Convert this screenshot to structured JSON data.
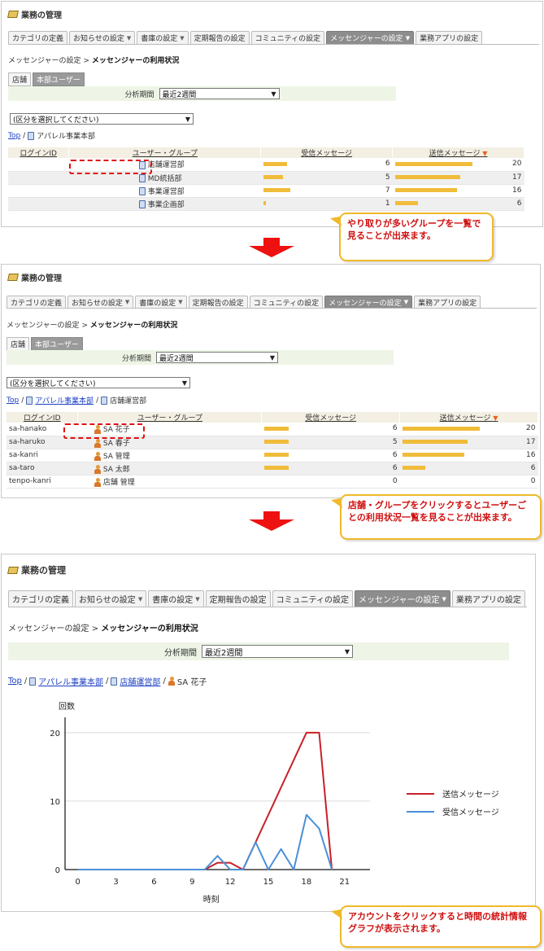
{
  "header_title": "業務の管理",
  "tabs": [
    {
      "label": "カテゴリの定義",
      "dropdown": false
    },
    {
      "label": "お知らせの設定",
      "dropdown": true
    },
    {
      "label": "書庫の設定",
      "dropdown": true
    },
    {
      "label": "定期報告の設定",
      "dropdown": false
    },
    {
      "label": "コミュニティの設定",
      "dropdown": false
    },
    {
      "label": "メッセンジャーの設定",
      "dropdown": true,
      "active": true
    },
    {
      "label": "業務アプリの設定",
      "dropdown": false
    }
  ],
  "breadcrumb": {
    "parent": "メッセンジャーの設定",
    "separator": ">",
    "current": "メッセンジャーの利用状況"
  },
  "subtabs": [
    "店舗",
    "本部ユーザー"
  ],
  "period_label": "分析期間",
  "period_value": "最近2週間",
  "division_placeholder": "(区分を選択してください)",
  "nav": {
    "top": "Top",
    "sep": "/",
    "apparel": "アパレル事業本部",
    "store_ops": "店舗運営部",
    "user": "SA 花子"
  },
  "columns": {
    "login_id": "ログインID",
    "user_group": "ユーザー・グループ",
    "received": "受信メッセージ",
    "sent": "送信メッセージ"
  },
  "panel1_rows": [
    {
      "login_id": "",
      "name": "店舗運営部",
      "received": "6",
      "received_frac": 0.29,
      "sent": "20",
      "sent_frac": 0.95
    },
    {
      "login_id": "",
      "name": "MD統括部",
      "received": "5",
      "received_frac": 0.24,
      "sent": "17",
      "sent_frac": 0.8
    },
    {
      "login_id": "",
      "name": "事業運営部",
      "received": "7",
      "received_frac": 0.33,
      "sent": "16",
      "sent_frac": 0.76
    },
    {
      "login_id": "",
      "name": "事業企画部",
      "received": "1",
      "received_frac": 0.03,
      "sent": "6",
      "sent_frac": 0.28
    }
  ],
  "panel2_rows": [
    {
      "login_id": "sa-hanako",
      "name": "SA 花子",
      "received": "6",
      "received_frac": 0.3,
      "sent": "20",
      "sent_frac": 0.95
    },
    {
      "login_id": "sa-haruko",
      "name": "SA 春子",
      "received": "5",
      "received_frac": 0.3,
      "sent": "17",
      "sent_frac": 0.8
    },
    {
      "login_id": "sa-kanri",
      "name": "SA 管理",
      "received": "6",
      "received_frac": 0.3,
      "sent": "16",
      "sent_frac": 0.76
    },
    {
      "login_id": "sa-taro",
      "name": "SA 太郎",
      "received": "6",
      "received_frac": 0.3,
      "sent": "6",
      "sent_frac": 0.28
    },
    {
      "login_id": "tenpo-kanri",
      "name": "店舗 管理",
      "received": "0",
      "received_frac": 0,
      "sent": "0",
      "sent_frac": 0
    }
  ],
  "callouts": [
    "やり取りが多いグループを一覧で見ることが出来ます。",
    "店舗・グループをクリックするとユーザーごとの利用状況一覧を見ることが出来ます。",
    "アカウントをクリックすると時間の統計情報グラフが表示されます。"
  ],
  "colors": {
    "sent": "#c8202a",
    "received": "#4a8fd8",
    "bar": "#f0bc3a",
    "callout_border": "#f0b92a",
    "arrow": "#e11111"
  },
  "chart_data": {
    "type": "line",
    "ylabel": "回数",
    "xlabel": "時刻",
    "xlim": [
      -1,
      23
    ],
    "ylim": [
      0,
      22
    ],
    "xticks": [
      0,
      3,
      6,
      9,
      12,
      15,
      18,
      21
    ],
    "yticks": [
      0,
      10,
      20
    ],
    "grid": true,
    "legend_position": "right",
    "series": [
      {
        "name": "送信メッセージ",
        "color": "#c8202a",
        "points": [
          [
            0,
            0
          ],
          [
            10,
            0
          ],
          [
            11,
            1
          ],
          [
            12,
            1
          ],
          [
            13,
            0
          ],
          [
            18,
            20
          ],
          [
            19,
            20
          ],
          [
            20,
            0
          ]
        ]
      },
      {
        "name": "受信メッセージ",
        "color": "#4a8fd8",
        "points": [
          [
            0,
            0
          ],
          [
            10,
            0
          ],
          [
            11,
            2
          ],
          [
            12,
            0
          ],
          [
            13,
            0
          ],
          [
            14,
            4
          ],
          [
            15,
            0
          ],
          [
            16,
            3
          ],
          [
            17,
            0
          ],
          [
            18,
            8
          ],
          [
            19,
            6
          ],
          [
            20,
            0
          ]
        ]
      }
    ]
  }
}
